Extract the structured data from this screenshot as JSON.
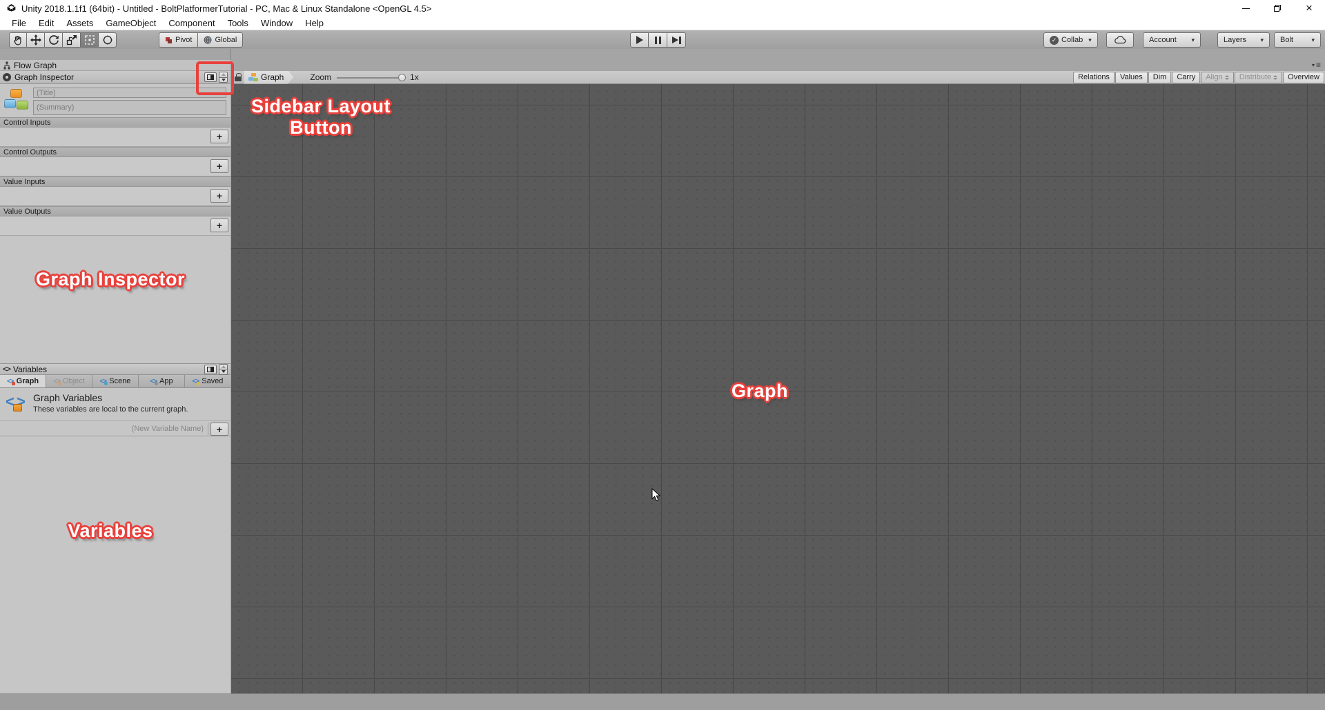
{
  "window": {
    "title": "Unity 2018.1.1f1 (64bit) - Untitled - BoltPlatformerTutorial - PC, Mac & Linux Standalone <OpenGL 4.5>"
  },
  "menu": {
    "items": [
      "File",
      "Edit",
      "Assets",
      "GameObject",
      "Component",
      "Tools",
      "Window",
      "Help"
    ]
  },
  "toolbar": {
    "pivot_label": "Pivot",
    "global_label": "Global",
    "collab_label": "Collab",
    "account_label": "Account",
    "layers_label": "Layers",
    "bolt_label": "Bolt"
  },
  "sidebar": {
    "flow_graph_tab": "Flow Graph",
    "inspector": {
      "title": "Graph Inspector",
      "title_placeholder": "(Title)",
      "summary_placeholder": "(Summary)",
      "sections": [
        {
          "label": "Control Inputs",
          "add": "+"
        },
        {
          "label": "Control Outputs",
          "add": "+"
        },
        {
          "label": "Value Inputs",
          "add": "+"
        },
        {
          "label": "Value Outputs",
          "add": "+"
        }
      ]
    },
    "variables": {
      "title": "Variables",
      "tabs": [
        {
          "label": "Graph"
        },
        {
          "label": "Object"
        },
        {
          "label": "Scene"
        },
        {
          "label": "App"
        },
        {
          "label": "Saved"
        }
      ],
      "info_title": "Graph Variables",
      "info_desc": "These variables are local to the current graph.",
      "new_placeholder": "(New Variable Name)",
      "add": "+"
    }
  },
  "graph": {
    "breadcrumb": "Graph",
    "zoom_label": "Zoom",
    "zoom_value": "1x",
    "buttons": [
      {
        "label": "Relations"
      },
      {
        "label": "Values"
      },
      {
        "label": "Dim"
      },
      {
        "label": "Carry"
      },
      {
        "label": "Align"
      },
      {
        "label": "Distribute"
      },
      {
        "label": "Overview"
      }
    ]
  },
  "annotations": {
    "sidebar_layout_line1": "Sidebar Layout",
    "sidebar_layout_line2": "Button",
    "graph_inspector": "Graph Inspector",
    "graph": "Graph",
    "variables": "Variables",
    "accent_color": "#e8413c"
  }
}
